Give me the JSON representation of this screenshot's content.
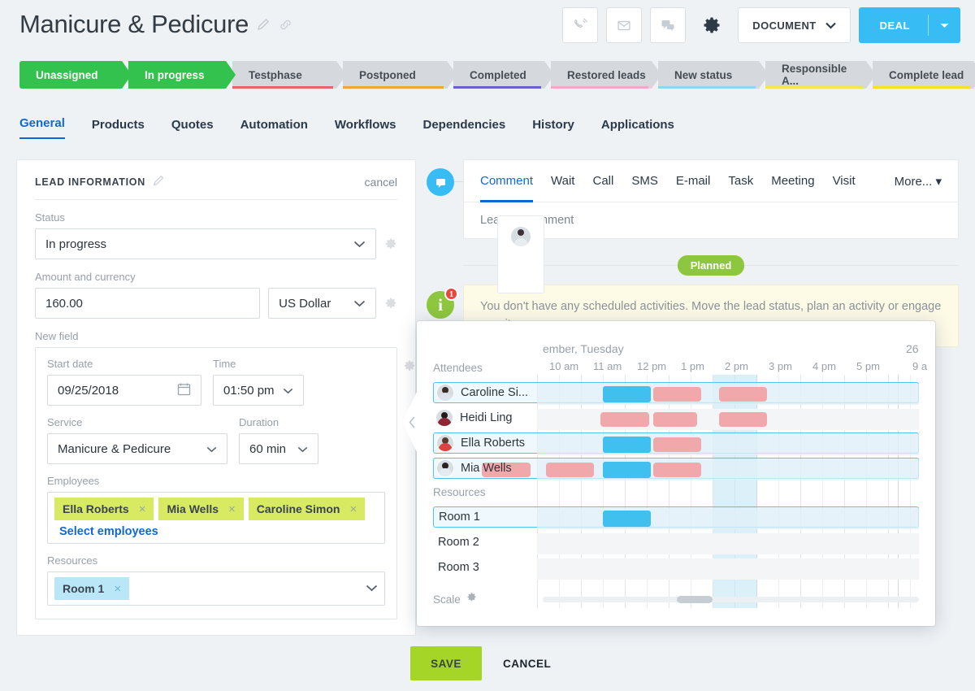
{
  "header": {
    "title": "Manicure & Pedicure",
    "edit_icon": "pencil-icon",
    "link_icon": "link-icon",
    "toolbar": {
      "call_icon": "phone-icon",
      "email_icon": "envelope-icon",
      "chat_icon": "chat-icon",
      "settings_icon": "gear-icon",
      "document_label": "DOCUMENT",
      "deal_label": "DEAL"
    }
  },
  "pipeline": [
    {
      "label": "Unassigned",
      "state": "green",
      "accent": ""
    },
    {
      "label": "In progress",
      "state": "green",
      "accent": ""
    },
    {
      "label": "Testphase",
      "state": "gray",
      "accent": "#e9646c"
    },
    {
      "label": "Postponed",
      "state": "gray",
      "accent": "#f0a637"
    },
    {
      "label": "Completed",
      "state": "gray",
      "accent": "#6b5fd4"
    },
    {
      "label": "Restored leads",
      "state": "gray",
      "accent": "#f3a8c6"
    },
    {
      "label": "New status",
      "state": "gray",
      "accent": "#8fd7ee"
    },
    {
      "label": "Responsible A...",
      "state": "gray",
      "accent": "#f2e84e"
    },
    {
      "label": "Complete lead",
      "state": "gray",
      "accent": "#f2e222"
    }
  ],
  "tabs": [
    {
      "label": "General",
      "active": true
    },
    {
      "label": "Products",
      "active": false
    },
    {
      "label": "Quotes",
      "active": false
    },
    {
      "label": "Automation",
      "active": false
    },
    {
      "label": "Workflows",
      "active": false
    },
    {
      "label": "Dependencies",
      "active": false
    },
    {
      "label": "History",
      "active": false
    },
    {
      "label": "Applications",
      "active": false
    }
  ],
  "lead_info": {
    "section_title": "LEAD INFORMATION",
    "cancel_label": "cancel",
    "status_label": "Status",
    "status_value": "In progress",
    "amount_label": "Amount and currency",
    "amount_value": "160.00",
    "currency_value": "US Dollar",
    "new_field_label": "New field",
    "start_date_label": "Start date",
    "start_date_value": "09/25/2018",
    "time_label": "Time",
    "time_value": "01:50 pm",
    "service_label": "Service",
    "service_value": "Manicure & Pedicure",
    "duration_label": "Duration",
    "duration_value": "60 min",
    "employees_label": "Employees",
    "employees": [
      "Ella Roberts",
      "Mia Wells",
      "Caroline Simon"
    ],
    "select_employees_label": "Select employees",
    "resources_label": "Resources",
    "resources": [
      "Room 1"
    ]
  },
  "activity": {
    "tabs": [
      {
        "label": "Comment",
        "active": true
      },
      {
        "label": "Wait",
        "active": false
      },
      {
        "label": "Call",
        "active": false
      },
      {
        "label": "SMS",
        "active": false
      },
      {
        "label": "E-mail",
        "active": false
      },
      {
        "label": "Task",
        "active": false
      },
      {
        "label": "Meeting",
        "active": false
      },
      {
        "label": "Visit",
        "active": false
      }
    ],
    "more_label": "More...",
    "comment_placeholder": "Leave a comment",
    "planned_badge": "Planned",
    "notice_text": "You don't have any scheduled activities. Move the lead status, plan an activity or engage a wait.",
    "notice_count": "1"
  },
  "scheduler": {
    "date_header": "ember, Tuesday",
    "date_header_right": "26",
    "attendees_label": "Attendees",
    "resources_label": "Resources",
    "scale_label": "Scale",
    "scale_gear_icon": "gear-icon",
    "hours": [
      "10 am",
      "11 am",
      "12 pm",
      "1 pm",
      "2 pm",
      "3 pm",
      "4 pm",
      "5 pm"
    ],
    "hour_right": "9 a",
    "attendees": [
      {
        "name": "Caroline Si...",
        "selected": true,
        "busy": [
          [
            2.5,
            1.1
          ],
          [
            4.0,
            1.1
          ]
        ],
        "chosen": [
          1.35,
          1.1
        ]
      },
      {
        "name": "Heidi Ling",
        "selected": false,
        "busy": [
          [
            1.3,
            1.1
          ],
          [
            2.5,
            1.0
          ],
          [
            4.0,
            1.1
          ]
        ],
        "chosen": null
      },
      {
        "name": "Ella Roberts",
        "selected": true,
        "busy": [
          [
            2.5,
            1.1
          ]
        ],
        "chosen": [
          1.35,
          1.1
        ]
      },
      {
        "name": "Mia Wells",
        "selected": true,
        "busy": [
          [
            -1.4,
            1.1
          ],
          [
            0.05,
            1.1
          ],
          [
            2.5,
            1.1
          ]
        ],
        "chosen": [
          1.35,
          1.1
        ]
      }
    ],
    "resources": [
      {
        "name": "Room 1",
        "selected": true,
        "chosen": [
          1.35,
          1.1
        ]
      },
      {
        "name": "Room 2",
        "selected": false,
        "chosen": null
      },
      {
        "name": "Room 3",
        "selected": false,
        "chosen": null
      }
    ]
  },
  "footer": {
    "save_label": "SAVE",
    "cancel_label": "CANCEL"
  }
}
